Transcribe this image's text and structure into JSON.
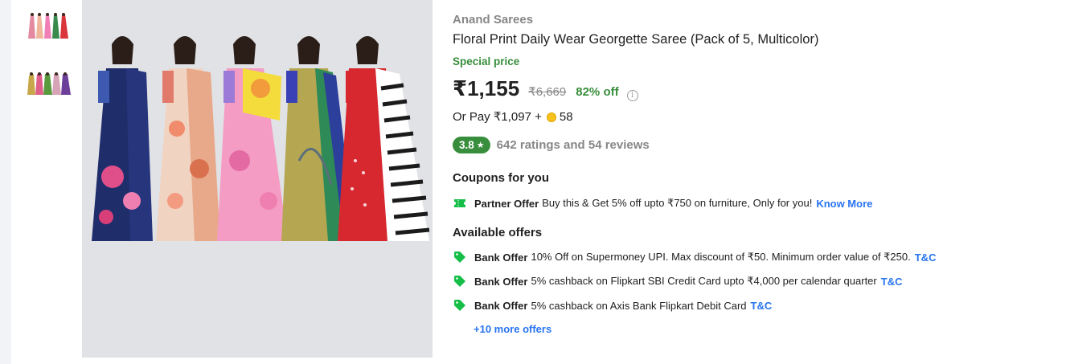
{
  "colors": {
    "green": "#388e3c",
    "blue": "#2874f0",
    "grey": "#878787",
    "image_bg": "#e1e2e6"
  },
  "thumbnails": [
    {
      "alt": "saree thumbnail 1"
    },
    {
      "alt": "saree thumbnail 2"
    }
  ],
  "product": {
    "brand": "Anand Sarees",
    "title": "Floral Print Daily Wear Georgette Saree  (Pack of 5, Multicolor)",
    "special_label": "Special price",
    "price": "₹1,155",
    "mrp": "₹6,669",
    "discount": "82% off",
    "info_icon": "i",
    "or_pay_text": "Or Pay ₹1,097 +",
    "coins": "58",
    "rating": "3.8",
    "rating_star": "★",
    "reviews": "642 ratings and 54 reviews"
  },
  "coupons": {
    "heading": "Coupons for you",
    "items": [
      {
        "icon": "ticket-icon",
        "title": "Partner Offer",
        "text": "Buy this & Get 5% off upto ₹750 on furniture, Only for you!",
        "link": "Know More"
      }
    ]
  },
  "offers": {
    "heading": "Available offers",
    "items": [
      {
        "icon": "tag-icon",
        "title": "Bank Offer",
        "text": "10% Off on Supermoney UPI. Max discount of ₹50. Minimum order value of ₹250.",
        "link": "T&C"
      },
      {
        "icon": "tag-icon",
        "title": "Bank Offer",
        "text": "5% cashback on Flipkart SBI Credit Card upto ₹4,000 per calendar quarter",
        "link": "T&C"
      },
      {
        "icon": "tag-icon",
        "title": "Bank Offer",
        "text": "5% cashback on Axis Bank Flipkart Debit Card",
        "link": "T&C"
      }
    ],
    "more": "+10 more offers"
  }
}
